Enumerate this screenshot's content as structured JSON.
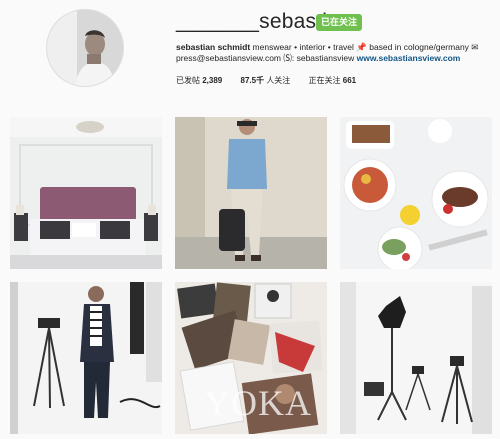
{
  "profile": {
    "username": "_______sebastian",
    "follow_label": "已在关注",
    "bio_name": "sebastian schmidt",
    "bio_line1_rest": " menswear • interior • travel 📌 based in cologne/germany ✉",
    "bio_line2": "press@sebastiansview.com 🄢: sebastiansview ",
    "website": "www.sebastiansview.com",
    "posts_label": "已发帖",
    "posts_value": "2,389",
    "followers_value": "87.5千",
    "followers_label": "人关注",
    "following_label": "正在关注",
    "following_value": "661"
  },
  "posts": [
    {
      "name": "post-bedroom"
    },
    {
      "name": "post-man-wall"
    },
    {
      "name": "post-breakfast"
    },
    {
      "name": "post-studio-man"
    },
    {
      "name": "post-photos"
    },
    {
      "name": "post-studio-lights"
    }
  ],
  "watermark": "YOKA"
}
